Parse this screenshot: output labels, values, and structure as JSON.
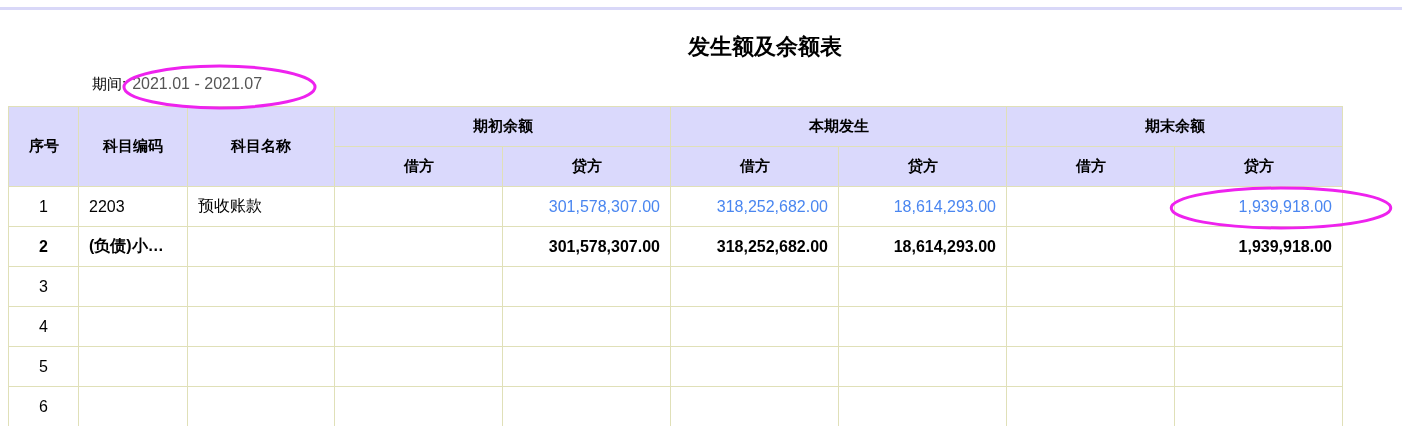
{
  "title": "发生额及余额表",
  "period": {
    "label": "期间:",
    "value": "2021.01 - 2021.07",
    "circled": true
  },
  "table": {
    "columns": [
      {
        "label": "序号"
      },
      {
        "label": "科目编码"
      },
      {
        "label": "科目名称"
      },
      {
        "label": "期初余额",
        "colspan": 2,
        "children": [
          {
            "label": "借方"
          },
          {
            "label": "贷方"
          }
        ]
      },
      {
        "label": "本期发生",
        "colspan": 2,
        "children": [
          {
            "label": "借方"
          },
          {
            "label": "贷方"
          }
        ]
      },
      {
        "label": "期末余额",
        "colspan": 2,
        "children": [
          {
            "label": "借方"
          },
          {
            "label": "贷方"
          }
        ]
      }
    ],
    "rows": [
      {
        "kind": "item",
        "cells": [
          "1",
          "2203",
          "预收账款",
          null,
          "301,578,307.00",
          "318,252,682.00",
          "18,614,293.00",
          null,
          {
            "text": "1,939,918.00",
            "circled": true
          }
        ]
      },
      {
        "kind": "subtotal",
        "cells": [
          "2",
          "(负债)小…",
          null,
          null,
          "301,578,307.00",
          "318,252,682.00",
          "18,614,293.00",
          null,
          "1,939,918.00"
        ]
      },
      {
        "kind": "empty",
        "cells": [
          "3"
        ]
      },
      {
        "kind": "empty",
        "cells": [
          "4"
        ]
      },
      {
        "kind": "empty",
        "cells": [
          "5"
        ]
      },
      {
        "kind": "empty",
        "cells": [
          "6"
        ]
      }
    ]
  }
}
